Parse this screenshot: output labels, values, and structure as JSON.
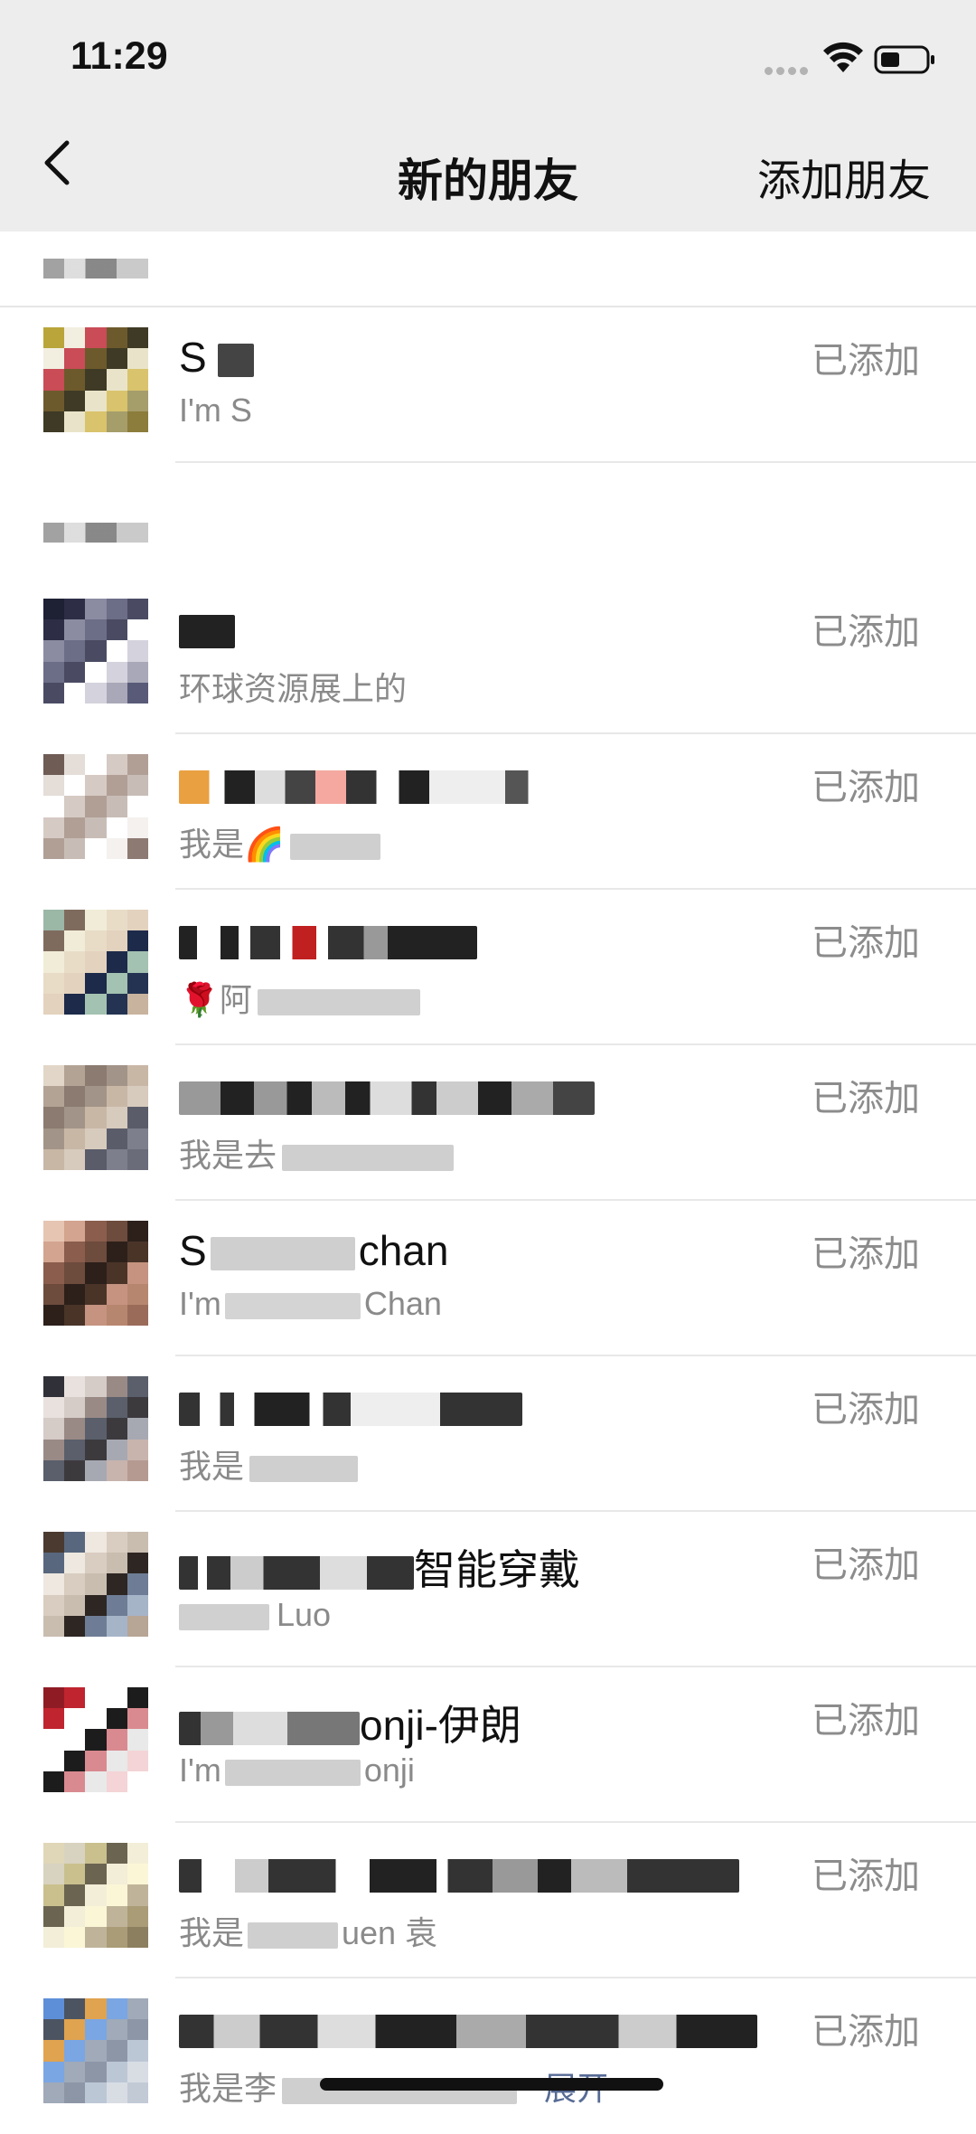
{
  "status_bar": {
    "time": "11:29"
  },
  "nav": {
    "title": "新的朋友",
    "action": "添加朋友"
  },
  "rows": [
    {
      "name": "S",
      "sub": "I'm S",
      "status": "已添加",
      "emoji_sub": ""
    },
    {
      "name": "",
      "sub": "环球资源展上的",
      "status": "已添加"
    },
    {
      "name": "",
      "sub": "我是",
      "status": "已添加",
      "emoji": "🌈"
    },
    {
      "name": "",
      "sub": "阿",
      "status": "已添加",
      "emoji": "🌹"
    },
    {
      "name": "",
      "sub": "我是去",
      "status": "已添加"
    },
    {
      "name": "chan",
      "name_prefix": "S",
      "sub": "Chan",
      "sub_prefix": "I'm",
      "status": "已添加"
    },
    {
      "name": "",
      "sub": "我是",
      "status": "已添加"
    },
    {
      "name": "智能穿戴",
      "sub": "Luo",
      "status": "已添加"
    },
    {
      "name": "onji-伊朗",
      "sub": "onji",
      "sub_prefix": "I'm",
      "status": "已添加"
    },
    {
      "name": "",
      "sub": "uen 袁",
      "sub_prefix": "我是",
      "status": "已添加"
    },
    {
      "name": "",
      "sub": "我是李",
      "status": "已添加",
      "expand": "展开"
    }
  ],
  "colors": {
    "status_text": "#8c8c8c",
    "link": "#576b95",
    "nav_bg": "#ededed"
  }
}
